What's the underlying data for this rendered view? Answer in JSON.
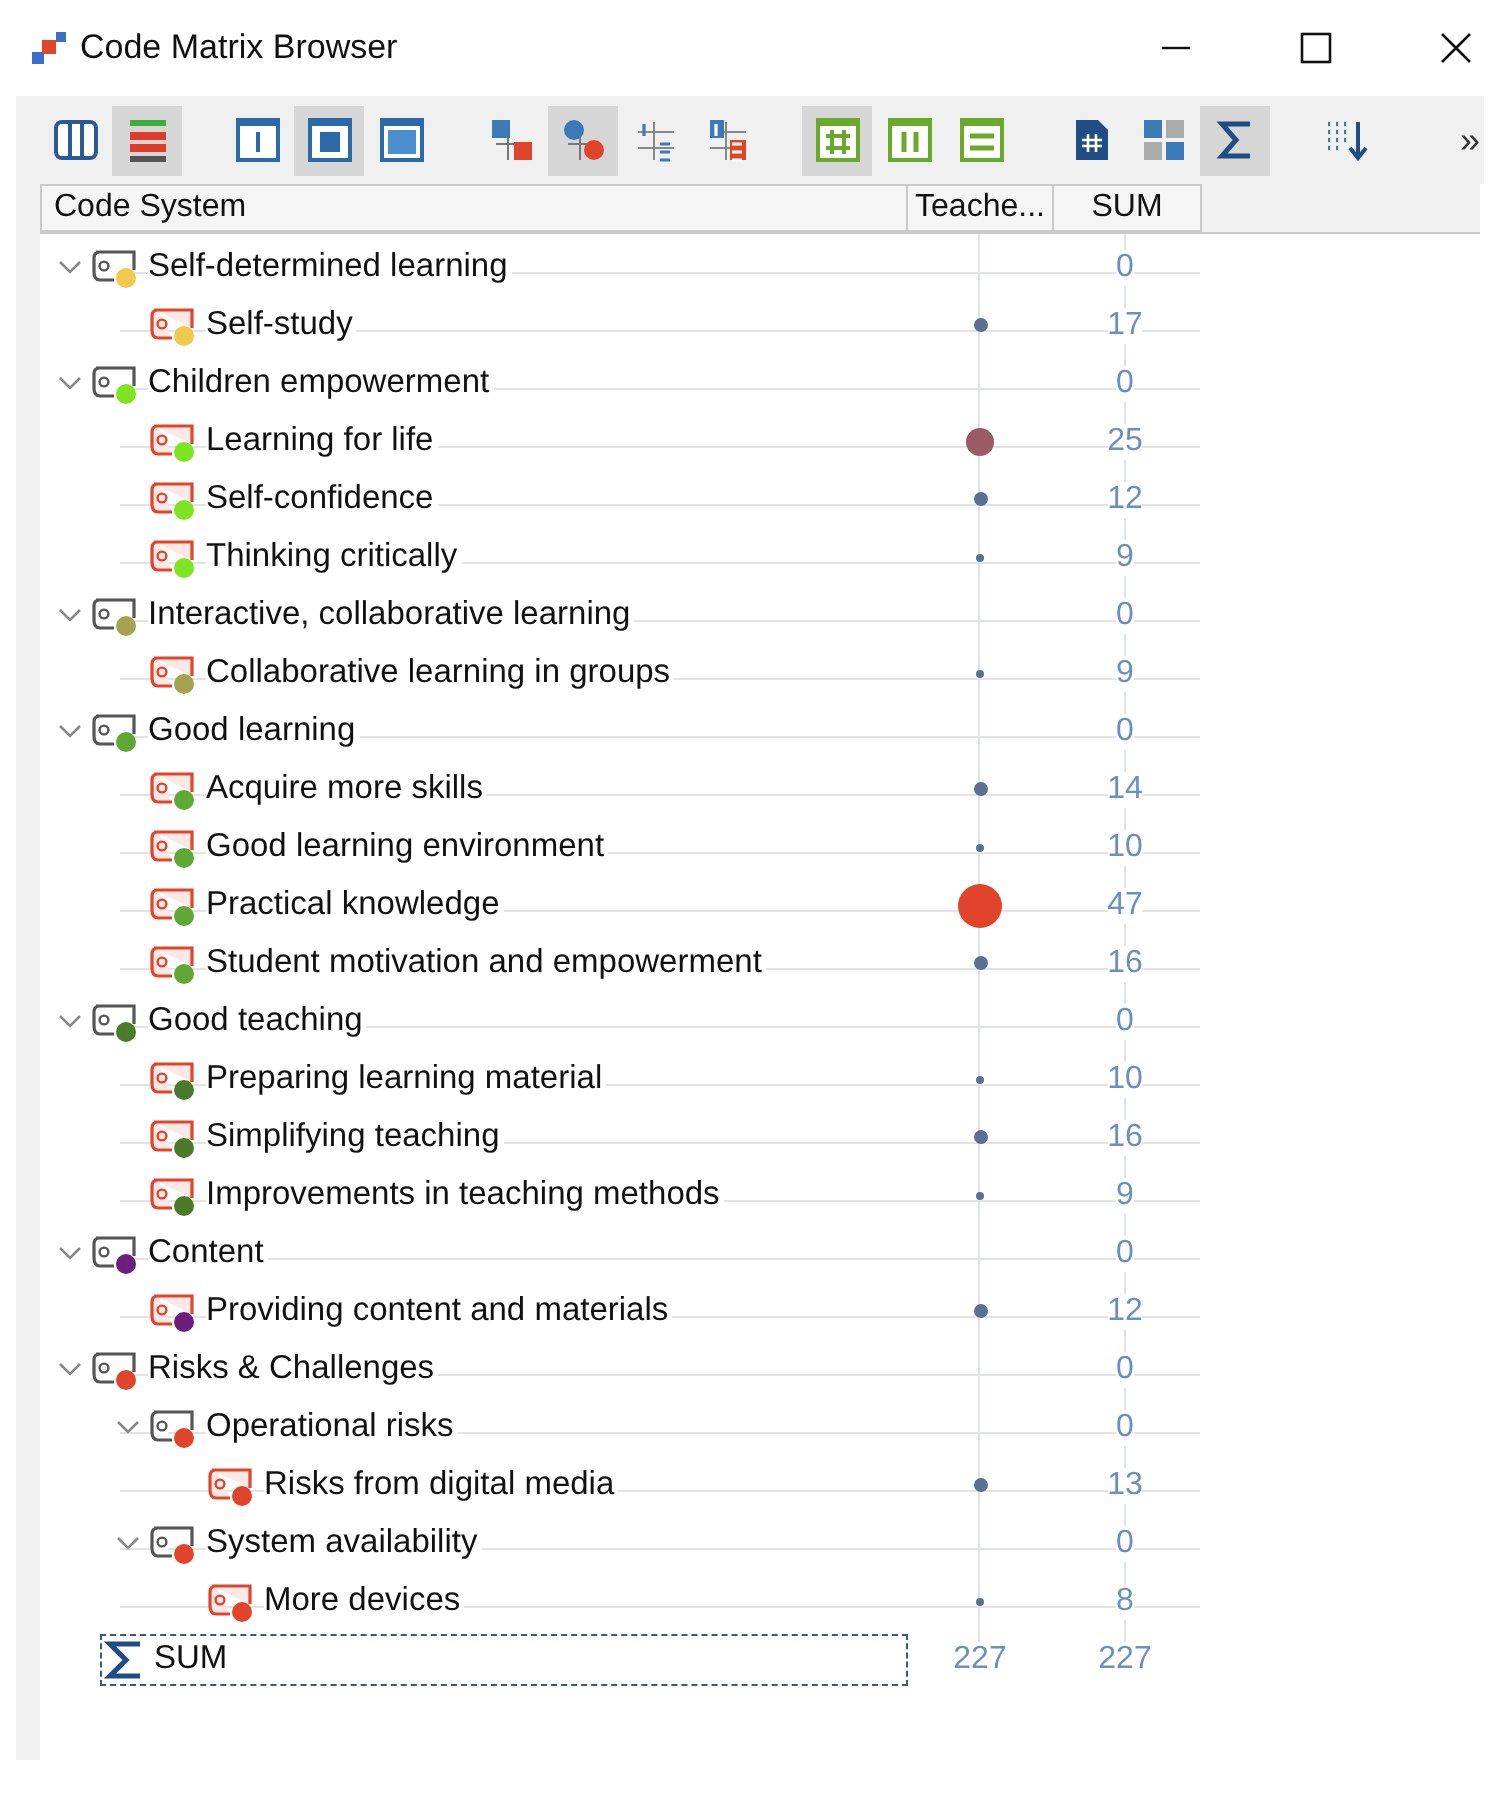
{
  "window": {
    "title": "Code Matrix Browser"
  },
  "toolbar": [
    [
      {
        "selected": false
      },
      {
        "selected": true
      }
    ],
    [
      {
        "selected": false
      },
      {
        "selected": true
      },
      {
        "selected": false
      }
    ],
    [
      {
        "selected": false
      },
      {
        "selected": true
      },
      {
        "selected": false
      },
      {
        "selected": false
      }
    ],
    [
      {
        "selected": true
      },
      {
        "selected": false
      },
      {
        "selected": false
      }
    ],
    [
      {
        "selected": false
      },
      {
        "selected": false
      },
      {
        "selected": true
      }
    ],
    [
      {
        "selected": false
      }
    ]
  ],
  "toolbar_overflow": "»",
  "columns": [
    "Code System",
    "Teache...",
    "SUM"
  ],
  "codes": [
    {
      "kind": "category",
      "label": "Self-determined learning",
      "color": "#f2c94c",
      "expanded": true,
      "sum": "0",
      "children": [
        {
          "kind": "code",
          "label": "Self-study",
          "color": "#f2c94c",
          "sum": "17"
        }
      ]
    },
    {
      "kind": "category",
      "label": "Children empowerment",
      "color": "#7ee321",
      "expanded": true,
      "sum": "0",
      "children": [
        {
          "kind": "code",
          "label": "Learning for life",
          "color": "#7ee321",
          "sum": "25"
        },
        {
          "kind": "code",
          "label": "Self-confidence",
          "color": "#7ee321",
          "sum": "12"
        },
        {
          "kind": "code",
          "label": "Thinking critically",
          "color": "#7ee321",
          "sum": "9"
        }
      ]
    },
    {
      "kind": "category",
      "label": "Interactive, collaborative learning",
      "color": "#a3a350",
      "expanded": true,
      "sum": "0",
      "children": [
        {
          "kind": "code",
          "label": "Collaborative learning in groups",
          "color": "#a3a350",
          "sum": "9"
        }
      ]
    },
    {
      "kind": "category",
      "label": "Good learning",
      "color": "#5fa834",
      "expanded": true,
      "sum": "0",
      "children": [
        {
          "kind": "code",
          "label": "Acquire more skills",
          "color": "#5fa834",
          "sum": "14"
        },
        {
          "kind": "code",
          "label": "Good learning environment",
          "color": "#5fa834",
          "sum": "10"
        },
        {
          "kind": "code",
          "label": "Practical knowledge",
          "color": "#5fa834",
          "sum": "47"
        },
        {
          "kind": "code",
          "label": "Student motivation and empowerment",
          "color": "#5fa834",
          "sum": "16"
        }
      ]
    },
    {
      "kind": "category",
      "label": "Good teaching",
      "color": "#4b7a2b",
      "expanded": true,
      "sum": "0",
      "children": [
        {
          "kind": "code",
          "label": "Preparing learning material",
          "color": "#4b7a2b",
          "sum": "10"
        },
        {
          "kind": "code",
          "label": "Simplifying teaching",
          "color": "#4b7a2b",
          "sum": "16"
        },
        {
          "kind": "code",
          "label": "Improvements in teaching methods",
          "color": "#4b7a2b",
          "sum": "9"
        }
      ]
    },
    {
      "kind": "category",
      "label": "Content",
      "color": "#6b1e7c",
      "expanded": true,
      "sum": "0",
      "children": [
        {
          "kind": "code",
          "label": "Providing content and materials",
          "color": "#6b1e7c",
          "sum": "12"
        }
      ]
    },
    {
      "kind": "category",
      "label": "Risks & Challenges",
      "color": "#e0442a",
      "expanded": true,
      "sum": "0",
      "children": [
        {
          "kind": "category",
          "label": "Operational risks",
          "color": "#e0442a",
          "expanded": true,
          "sum": "0",
          "children": [
            {
              "kind": "code",
              "label": "Risks from digital media",
              "color": "#e0442a",
              "sum": "13"
            }
          ]
        },
        {
          "kind": "category",
          "label": "System availability",
          "color": "#e0442a",
          "expanded": true,
          "sum": "0",
          "children": [
            {
              "kind": "code",
              "label": "More devices",
              "color": "#e0442a",
              "sum": "8"
            }
          ]
        }
      ]
    }
  ],
  "sum_row": {
    "label": "SUM",
    "teacher": "227",
    "sum": "227"
  }
}
